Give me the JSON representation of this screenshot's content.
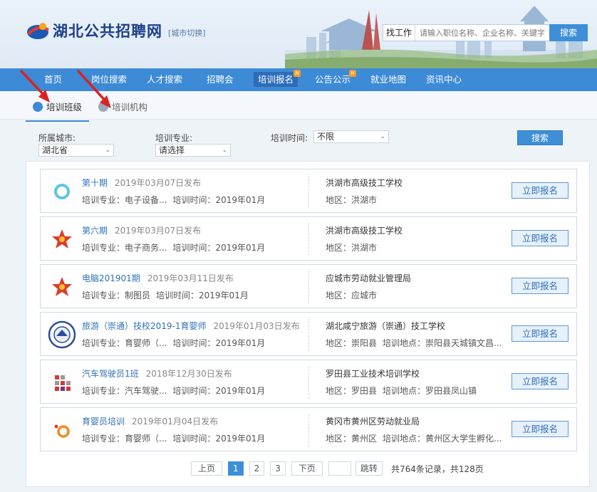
{
  "header": {
    "site_title": "湖北公共招聘网",
    "city_switch": "[城市切换]",
    "search_type": "找工作",
    "search_placeholder": "请输入职位名称、企业名称、关键字",
    "search_button": "搜索"
  },
  "nav": {
    "items": [
      {
        "label": "首页"
      },
      {
        "label": "岗位搜索"
      },
      {
        "label": "人才搜索"
      },
      {
        "label": "招聘会"
      },
      {
        "label": "培训报名"
      },
      {
        "label": "公告公示"
      },
      {
        "label": "就业地图"
      },
      {
        "label": "资讯中心"
      }
    ],
    "active_index": 4
  },
  "tabs": [
    {
      "label": "培训班级"
    },
    {
      "label": "培训机构"
    }
  ],
  "filters": {
    "city_label": "所属城市:",
    "city_value": "湖北省",
    "major_label": "培训专业:",
    "major_value": "请选择",
    "time_label": "培训时间:",
    "time_value": "不限",
    "search_button": "搜索"
  },
  "list": [
    {
      "title": "第十期",
      "date": "2019年03月07日发布",
      "major": "培训专业：电子设备...",
      "time": "培训时间：2019年01月",
      "school": "洪湖市高级技工学校",
      "region": "地区：洪湖市",
      "location": "",
      "button": "立即报名"
    },
    {
      "title": "第六期",
      "date": "2019年03月07日发布",
      "major": "培训专业：电子商务...",
      "time": "培训时间：2019年01月",
      "school": "洪湖市高级技工学校",
      "region": "地区：洪湖市",
      "location": "",
      "button": "立即报名"
    },
    {
      "title": "电脑201901期",
      "date": "2019年03月11日发布",
      "major": "培训专业：制图员",
      "time": "培训时间：2019年01月",
      "school": "应城市劳动就业管理局",
      "region": "地区：应城市",
      "location": "",
      "button": "立即报名"
    },
    {
      "title": "旅游（崇通）技校2019-1育婴师",
      "date": "2019年01月03日发布",
      "major": "培训专业：育婴师（...",
      "time": "培训时间：2019年01月",
      "school": "湖北咸宁旅游（崇通）技工学校",
      "region": "地区：崇阳县",
      "location": "培训地点：崇阳县天城镇文昌...",
      "button": "立即报名"
    },
    {
      "title": "汽车驾驶员1班",
      "date": "2018年12月30日发布",
      "major": "培训专业：汽车驾驶...",
      "time": "培训时间：2019年01月",
      "school": "罗田县工业技术培训学校",
      "region": "地区：罗田县",
      "location": "培训地点：罗田县凤山镇",
      "button": "立即报名"
    },
    {
      "title": "育婴员培训",
      "date": "2019年01月04日发布",
      "major": "培训专业：育婴师（...",
      "time": "培训时间：2019年01月",
      "school": "黄冈市黄州区劳动就业局",
      "region": "地区：黄州区",
      "location": "培训地点：黄州区大学生孵化...",
      "button": "立即报名"
    }
  ],
  "pager": {
    "prev": "上页",
    "pages": [
      "1",
      "2",
      "3"
    ],
    "current": "1",
    "next": "下页",
    "jump": "跳转",
    "total": "共764条记录，共128页"
  },
  "colors": {
    "accent": "#3d8ad6",
    "link": "#3170b8",
    "arrow": "#d9231f"
  }
}
